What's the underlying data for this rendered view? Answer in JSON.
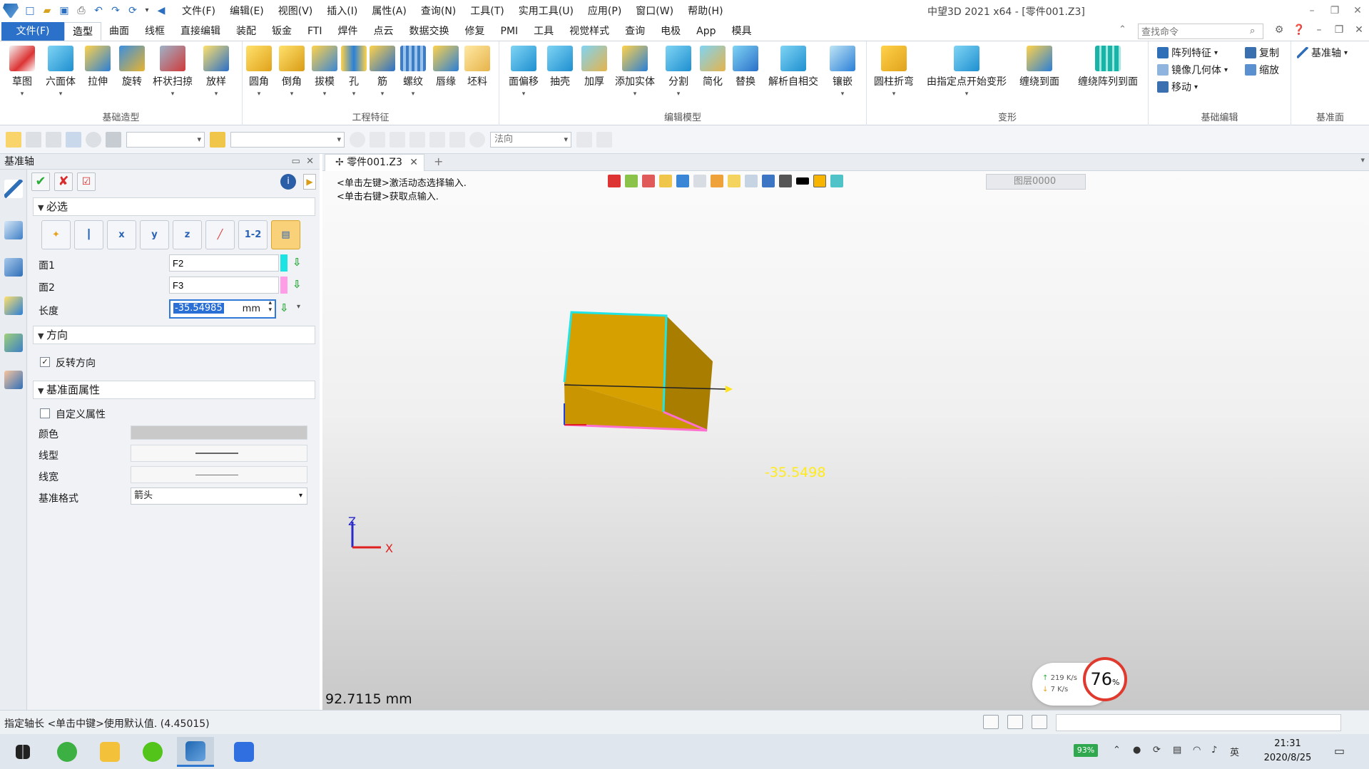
{
  "titlebar": {
    "title": "中望3D 2021 x64 - [零件001.Z3]",
    "menus": [
      "文件(F)",
      "编辑(E)",
      "视图(V)",
      "插入(I)",
      "属性(A)",
      "查询(N)",
      "工具(T)",
      "实用工具(U)",
      "应用(P)",
      "窗口(W)",
      "帮助(H)"
    ]
  },
  "ribbon_tabs": {
    "file": "文件(F)",
    "tabs": [
      "造型",
      "曲面",
      "线框",
      "直接编辑",
      "装配",
      "钣金",
      "FTI",
      "焊件",
      "点云",
      "数据交换",
      "修复",
      "PMI",
      "工具",
      "视觉样式",
      "查询",
      "电极",
      "App",
      "模具"
    ],
    "active": "造型",
    "search_placeholder": "查找命令"
  },
  "ribbon": {
    "groups": [
      "基础造型",
      "工程特征",
      "编辑模型",
      "变形",
      "基础编辑",
      "基准面"
    ],
    "tools": [
      "草图",
      "六面体",
      "拉伸",
      "旋转",
      "杆状扫掠",
      "放样",
      "圆角",
      "倒角",
      "拔模",
      "孔",
      "筋",
      "螺纹",
      "唇缘",
      "坯料",
      "面偏移",
      "抽壳",
      "加厚",
      "添加实体",
      "分割",
      "简化",
      "替换",
      "解析自相交",
      "镶嵌",
      "圆柱折弯",
      "由指定点开始变形",
      "缠绕到面",
      "缠绕阵列到面"
    ],
    "small_tools": [
      "阵列特征",
      "镜像几何体",
      "移动",
      "复制",
      "缩放",
      "基准轴"
    ]
  },
  "cmdbar": {
    "direction_combo": "法向"
  },
  "panel": {
    "title": "基准轴",
    "section_required": "必选",
    "method_icons": [
      "x",
      "y",
      "z",
      "1-2"
    ],
    "face1_label": "面1",
    "face1_value": "F2",
    "face2_label": "面2",
    "face2_value": "F3",
    "length_label": "长度",
    "length_value": "-35.54985",
    "length_unit": "mm",
    "section_direction": "方向",
    "reverse_label": "反转方向",
    "section_props": "基准面属性",
    "custom_label": "自定义属性",
    "color_label": "颜色",
    "linetype_label": "线型",
    "linewidth_label": "线宽",
    "format_label": "基准格式",
    "format_value": "箭头"
  },
  "document": {
    "tab": "零件001.Z3"
  },
  "viewport": {
    "hint1": "<单击左键>激活动态选择输入.",
    "hint2": "<单击右键>获取点输入.",
    "layer": "图层0000",
    "dimension": "-35.5498",
    "measure": "92.7115 mm",
    "axis_x": "X",
    "axis_z": "Z",
    "net_up": "219 K/s",
    "net_down": "7  K/s",
    "gauge": "76",
    "gauge_unit": "%",
    "colors": {
      "box_front": "#d6a000",
      "box_side": "#a87d00",
      "box_top": "#e5b21a",
      "edge_cyan": "#21e4e4",
      "edge_pink": "#ff6fd0"
    }
  },
  "statusbar": {
    "text": "指定轴长   <单击中键>使用默认值. (4.45015)"
  },
  "taskbar": {
    "battery": "93%",
    "time": "21:31",
    "date": "2020/8/25"
  }
}
